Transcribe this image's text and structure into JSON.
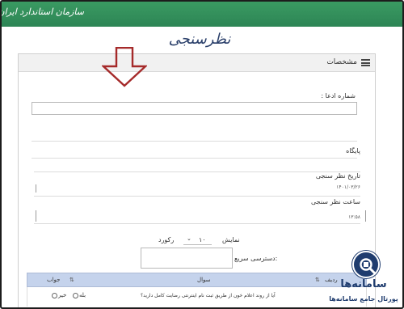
{
  "header": {
    "brand": "سازمان استاندارد ایران"
  },
  "page": {
    "title": "نظرسنجی"
  },
  "panel": {
    "heading": "مشخصات",
    "icon": "list-icon"
  },
  "annotation": {
    "icon": "down-arrow-icon",
    "color": "#a52a2a"
  },
  "fields": {
    "number_label": "شماره ادعا :",
    "base_label": "پایگاه",
    "date_label": "تاریخ نظر سنجی",
    "date_value": "۱۴۰۱/۰۳/۲۶",
    "time_label": "ساعت نظر سنجی",
    "time_value": "۱۳:۵۸"
  },
  "controls": {
    "show_label": "نمایش",
    "page_size": "۱۰",
    "records_label": "رکورد",
    "search_label": "دسترسی سریع:"
  },
  "table": {
    "columns": {
      "row": "ردیف",
      "question": "سوال",
      "answer": "جواب"
    },
    "header_color": "#c5d3ec",
    "rows": [
      {
        "question": "آیا از روند اعلام خون از طریق ثبت نام اینترنتی رضایت کامل دارید؟",
        "yes": "بله",
        "no": "خیر"
      }
    ]
  },
  "watermark": {
    "name": "سامانه‌ها",
    "subtitle": "پورتال جامع سامانه‌ها",
    "color": "#1f3c6e"
  }
}
